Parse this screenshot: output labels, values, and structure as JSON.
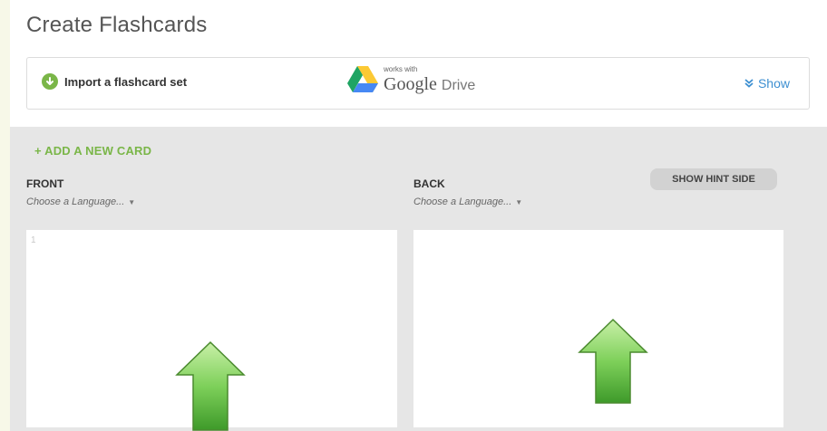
{
  "header": {
    "title": "Create Flashcards"
  },
  "import_bar": {
    "import_label": "Import a flashcard set",
    "gdrive_works_with": "works with",
    "gdrive_google": "Google",
    "gdrive_drive": "Drive",
    "show_label": "Show"
  },
  "editor": {
    "add_card_label": "+ ADD A NEW CARD",
    "front_label": "FRONT",
    "back_label": "BACK",
    "front_language": "Choose a Language...",
    "back_language": "Choose a Language...",
    "hint_button": "SHOW HINT SIDE",
    "front_line_number": "1"
  },
  "colors": {
    "accent_green": "#7ab648",
    "link_blue": "#3d8fd1",
    "arrow_green": "#5cb83d"
  },
  "icons": [
    "download-circle-icon",
    "google-drive-logo",
    "double-chevron-down-icon",
    "caret-down-icon",
    "up-arrow-annotation"
  ]
}
